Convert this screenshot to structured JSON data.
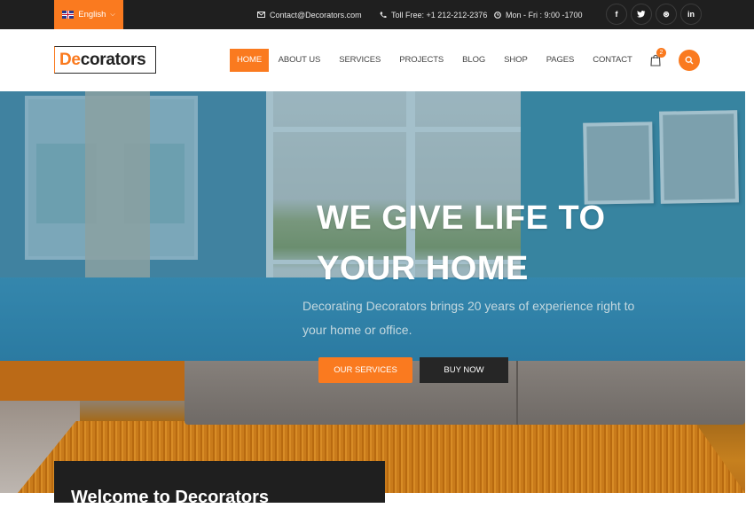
{
  "topbar": {
    "language": "English",
    "email": "Contact@Decorators.com",
    "phone": "Toll Free: +1 212-212-2376",
    "hours": "Mon - Fri : 9:00 -1700",
    "socials": [
      {
        "name": "facebook",
        "glyph": "f"
      },
      {
        "name": "twitter",
        "glyph": "t"
      },
      {
        "name": "dribbble",
        "glyph": "⊛"
      },
      {
        "name": "linkedin",
        "glyph": "in"
      }
    ]
  },
  "header": {
    "logo_accent": "De",
    "logo_rest": "corators",
    "nav": [
      "HOME",
      "ABOUT US",
      "SERVICES",
      "PROJECTS",
      "BLOG",
      "SHOP",
      "PAGES",
      "CONTACT"
    ],
    "active_nav": "HOME",
    "cart_count": "2"
  },
  "hero": {
    "title_line1": "WE GIVE LIFE TO",
    "title_line2": "YOUR HOME",
    "subtitle": "Decorating Decorators brings 20 years of experience right to your home or office.",
    "primary_button": "OUR SERVICES",
    "secondary_button": "BUY NOW"
  },
  "welcome": {
    "title": "Welcome to Decorators"
  },
  "colors": {
    "accent": "#fa7a1f",
    "dark": "#1f1f1f"
  }
}
